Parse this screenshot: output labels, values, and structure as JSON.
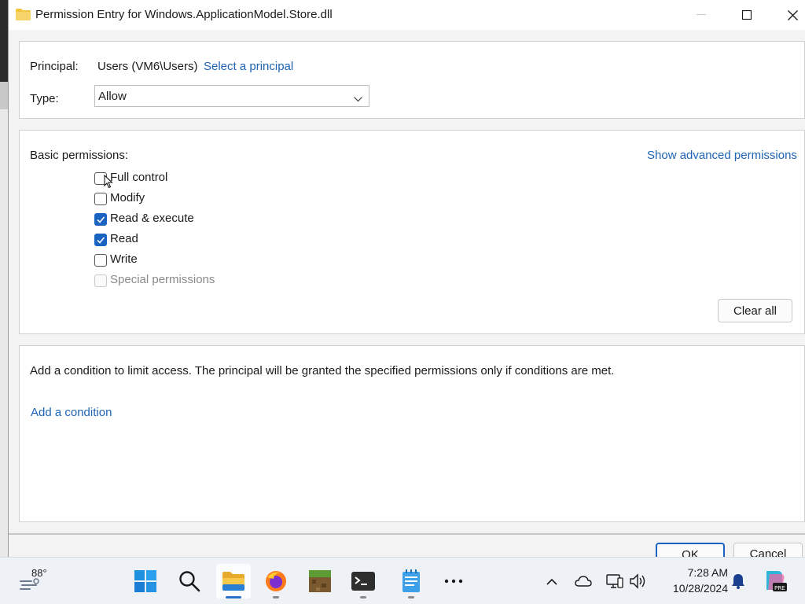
{
  "window": {
    "title": "Permission Entry for Windows.ApplicationModel.Store.dll"
  },
  "principal": {
    "principal_label": "Principal:",
    "principal_value": "Users (VM6\\Users)",
    "select_link": "Select a principal",
    "type_label": "Type:",
    "type_value": "Allow"
  },
  "permissions": {
    "heading": "Basic permissions:",
    "advanced_link": "Show advanced permissions",
    "items": [
      {
        "label": "Full control",
        "checked": false,
        "disabled": false
      },
      {
        "label": "Modify",
        "checked": false,
        "disabled": false
      },
      {
        "label": "Read & execute",
        "checked": true,
        "disabled": false
      },
      {
        "label": "Read",
        "checked": true,
        "disabled": false
      },
      {
        "label": "Write",
        "checked": false,
        "disabled": false
      },
      {
        "label": "Special permissions",
        "checked": false,
        "disabled": true
      }
    ],
    "clear_label": "Clear all"
  },
  "condition": {
    "description": "Add a condition to limit access. The principal will be granted the specified permissions only if conditions are met.",
    "add_link": "Add a condition"
  },
  "buttons": {
    "ok": "OK",
    "cancel": "Cancel"
  },
  "taskbar": {
    "weather_temp": "88°",
    "apps": [
      "start-icon",
      "search-icon",
      "file-explorer-icon",
      "firefox-icon",
      "minecraft-icon",
      "terminal-icon",
      "notepad-icon",
      "more-icon"
    ],
    "clock_time": "7:28 AM",
    "clock_date": "10/28/2024"
  },
  "colors": {
    "accent": "#1a63c1",
    "link": "#1e63b5"
  }
}
